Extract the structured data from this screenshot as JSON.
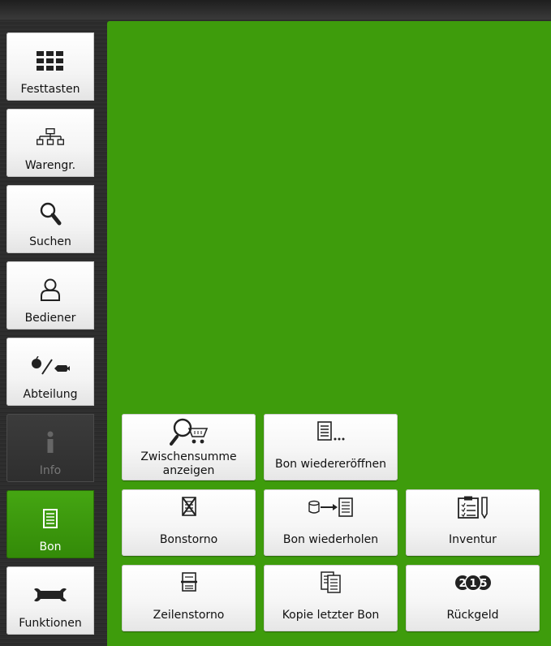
{
  "sidebar": {
    "items": [
      {
        "label": "Festtasten",
        "icon": "keypad-grid-icon",
        "state": "normal"
      },
      {
        "label": "Warengr.",
        "icon": "hierarchy-icon",
        "state": "normal"
      },
      {
        "label": "Suchen",
        "icon": "search-icon",
        "state": "normal"
      },
      {
        "label": "Bediener",
        "icon": "user-icon",
        "state": "normal"
      },
      {
        "label": "Abteilung",
        "icon": "department-icon",
        "state": "normal"
      },
      {
        "label": "Info",
        "icon": "info-icon",
        "state": "disabled"
      },
      {
        "label": "Bon",
        "icon": "receipt-icon",
        "state": "active"
      },
      {
        "label": "Funktionen",
        "icon": "wrench-icon",
        "state": "normal"
      }
    ]
  },
  "functions": {
    "subtotal": {
      "label": "Zwischensumme anzeigen",
      "icon": "subtotal-icon"
    },
    "reopen": {
      "label": "Bon wiedereröffnen",
      "icon": "reopen-receipt-icon"
    },
    "cancel_receipt": {
      "label": "Bonstorno",
      "icon": "cancel-receipt-icon"
    },
    "repeat_receipt": {
      "label": "Bon wiederholen",
      "icon": "repeat-receipt-icon"
    },
    "inventory": {
      "label": "Inventur",
      "icon": "inventory-icon"
    },
    "line_cancel": {
      "label": "Zeilenstorno",
      "icon": "line-cancel-icon"
    },
    "copy_last": {
      "label": "Kopie letzter Bon",
      "icon": "copy-receipt-icon"
    },
    "change": {
      "label": "Rückgeld",
      "icon": "coins-icon"
    }
  },
  "colors": {
    "accent_green": "#3e9c0c",
    "active_green": "#3b9a0e",
    "button_bg": "#f4f4f4",
    "background_dark": "#2e2e2e"
  }
}
